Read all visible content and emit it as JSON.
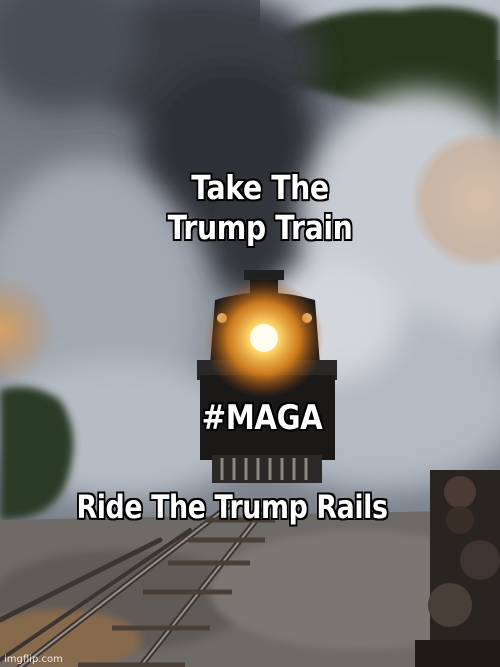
{
  "meme": {
    "top_line_1": "Take The",
    "top_line_2": "Trump Train",
    "middle": "#MAGA",
    "bottom": "Ride The Trump Rails"
  },
  "watermark": "imgflip.com",
  "colors": {
    "caption_fill": "#ffffff",
    "caption_outline": "#000000",
    "headlight": "#ffb838",
    "smoke": "#9aa2ab"
  }
}
